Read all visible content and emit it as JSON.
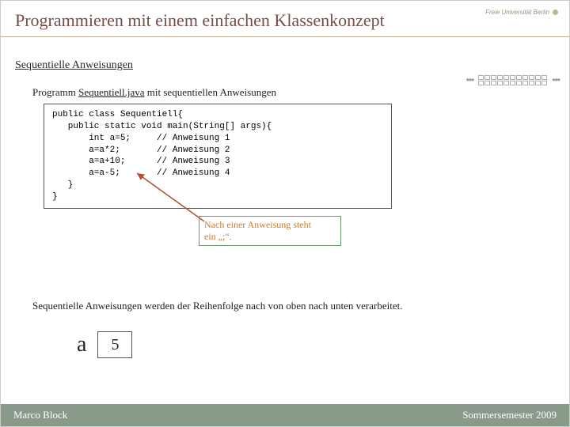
{
  "header": {
    "title": "Programmieren mit einem einfachen Klassenkonzept",
    "logo_text": "Freie Universität Berlin"
  },
  "section_title": "Sequentielle Anweisungen",
  "program_desc": {
    "pre": "Programm ",
    "link": "Sequentiell.java",
    "post": " mit sequentiellen Anweisungen"
  },
  "code": "public class Sequentiell{\n   public static void main(String[] args){\n       int a=5;     // Anweisung 1\n       a=a*2;       // Anweisung 2\n       a=a+10;      // Anweisung 3\n       a=a-5;       // Anweisung 4\n   }\n}",
  "annotation_line1": "Nach einer Anweisung steht",
  "annotation_line2": "ein „;“.",
  "body_text": "Sequentielle Anweisungen werden der Reihenfolge nach von oben nach unten verarbeitet.",
  "variable": {
    "name": "a",
    "value": "5"
  },
  "footer": {
    "left": "Marco Block",
    "right": "Sommersemester 2009"
  }
}
